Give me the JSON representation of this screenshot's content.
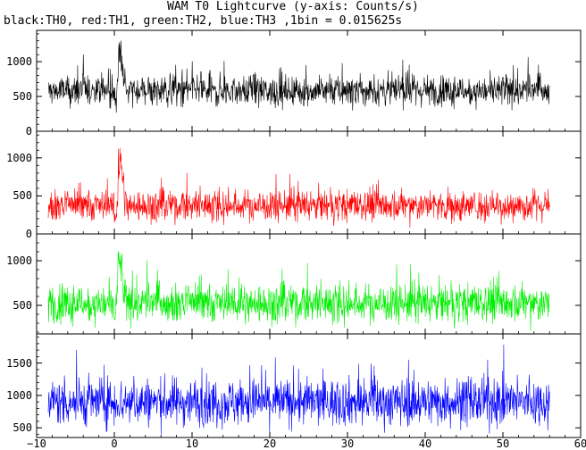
{
  "chart_data": {
    "type": "line",
    "title": "WAM T0 Lightcurve (y-axis: Counts/s)",
    "subtitle": "black:TH0, red:TH1, green:TH2, blue:TH3 ,1bin = 0.015625s",
    "xlim": [
      -10,
      60
    ],
    "x_ticks": [
      -10,
      0,
      10,
      20,
      30,
      40,
      50,
      60
    ],
    "x_tick_labels": [
      "−10",
      "0",
      "10",
      "20",
      "30",
      "40",
      "50",
      "60"
    ],
    "bin_seconds": 0.015625,
    "x_range_data": [
      -8.5,
      56
    ],
    "panels": [
      {
        "series": "TH0",
        "color": "#000000",
        "ylim": [
          0,
          1450
        ],
        "yticks": [
          0,
          500,
          1000
        ],
        "ytick_labels": [
          "0",
          "500",
          "1000"
        ],
        "baseline_mean": 580,
        "noise_amplitude": 200,
        "burst": {
          "peak_time": 0.8,
          "peak_value": 1450
        }
      },
      {
        "series": "TH1",
        "color": "#ff0000",
        "ylim": [
          0,
          1350
        ],
        "yticks": [
          0,
          500,
          1000
        ],
        "ytick_labels": [
          "0",
          "500",
          "1000"
        ],
        "baseline_mean": 370,
        "noise_amplitude": 190,
        "burst": {
          "peak_time": 0.8,
          "peak_value": 1300
        }
      },
      {
        "series": "TH2",
        "color": "#00ee00",
        "ylim": [
          180,
          1300
        ],
        "yticks": [
          500,
          1000
        ],
        "ytick_labels": [
          "500",
          "1000"
        ],
        "baseline_mean": 520,
        "noise_amplitude": 200,
        "burst": {
          "peak_time": 0.7,
          "peak_value": 1280
        }
      },
      {
        "series": "TH3",
        "color": "#0000ff",
        "ylim": [
          350,
          1950
        ],
        "yticks": [
          500,
          1000,
          1500
        ],
        "ytick_labels": [
          "500",
          "1000",
          "1500"
        ],
        "baseline_mean": 900,
        "noise_amplitude": 330,
        "burst": null
      }
    ]
  }
}
